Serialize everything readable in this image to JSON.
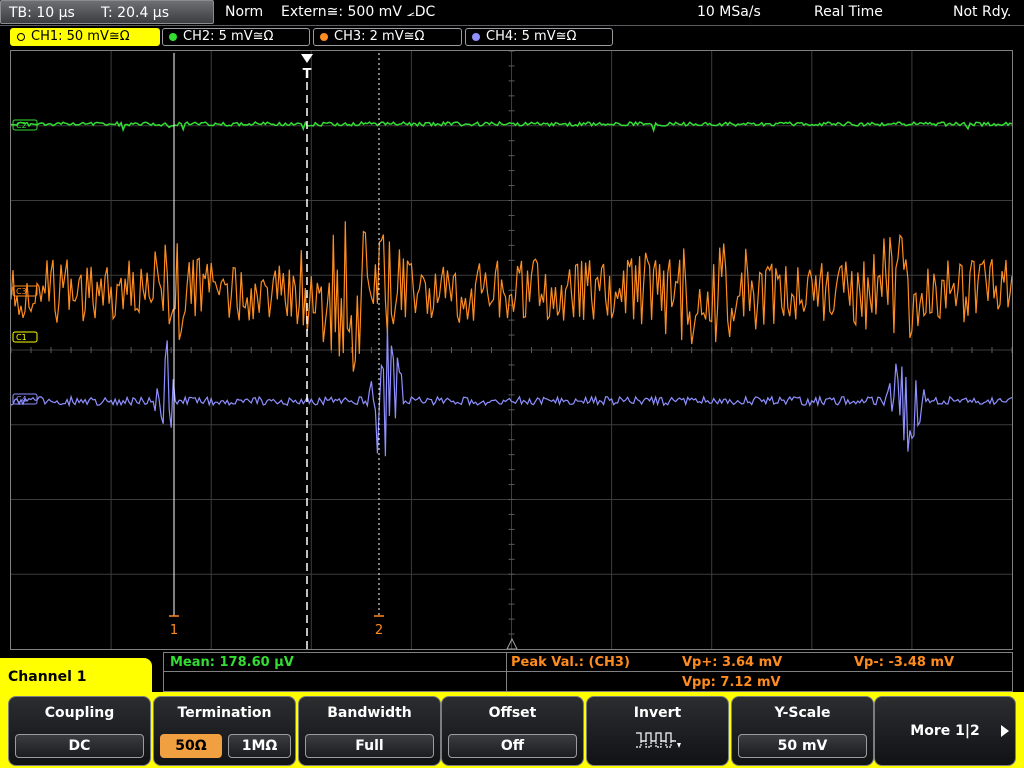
{
  "status": {
    "timebase": "TB: 10 µs",
    "trigger_time": "T: 20.4 µs",
    "mode": "Norm",
    "trigger_source": "Extern≅: 500 mV ⦟DC",
    "sample_rate": "10 MSa/s",
    "acq_mode": "Real Time",
    "state": "Not Rdy."
  },
  "channels": [
    {
      "label": "CH1: 50 mV≅Ω",
      "color": "#ffff00",
      "active": true
    },
    {
      "label": "CH2: 5 mV≅Ω",
      "color": "#33dd33",
      "active": false
    },
    {
      "label": "CH3: 2 mV≅Ω",
      "color": "#ff8c20",
      "active": false
    },
    {
      "label": "CH4: 5 mV≅Ω",
      "color": "#8f8fff",
      "active": false
    }
  ],
  "markers": {
    "cursor1": "1",
    "cursor2": "2",
    "trigger": "T"
  },
  "measurements": {
    "mean": "Mean: 178.60 µV",
    "peak_label": "Peak Val.:  (CH3)",
    "vp_plus": "Vp+: 3.64 mV",
    "vp_minus": "Vp-: -3.48 mV",
    "vpp": "Vpp: 7.12 mV"
  },
  "panel_title": "Channel 1",
  "softkeys": {
    "coupling": {
      "label": "Coupling",
      "value": "DC"
    },
    "termination": {
      "label": "Termination",
      "opt1": "50Ω",
      "opt2": "1MΩ"
    },
    "bandwidth": {
      "label": "Bandwidth",
      "value": "Full"
    },
    "offset": {
      "label": "Offset",
      "value": "Off"
    },
    "invert": {
      "label": "Invert"
    },
    "yscale": {
      "label": "Y-Scale",
      "value": "50 mV"
    },
    "more": {
      "label": "More 1|2"
    }
  },
  "colors": {
    "ch1": "#ffff00",
    "ch2": "#33dd33",
    "ch3": "#ff8c20",
    "ch4": "#8f8fff",
    "grid": "#3c3c3c"
  }
}
